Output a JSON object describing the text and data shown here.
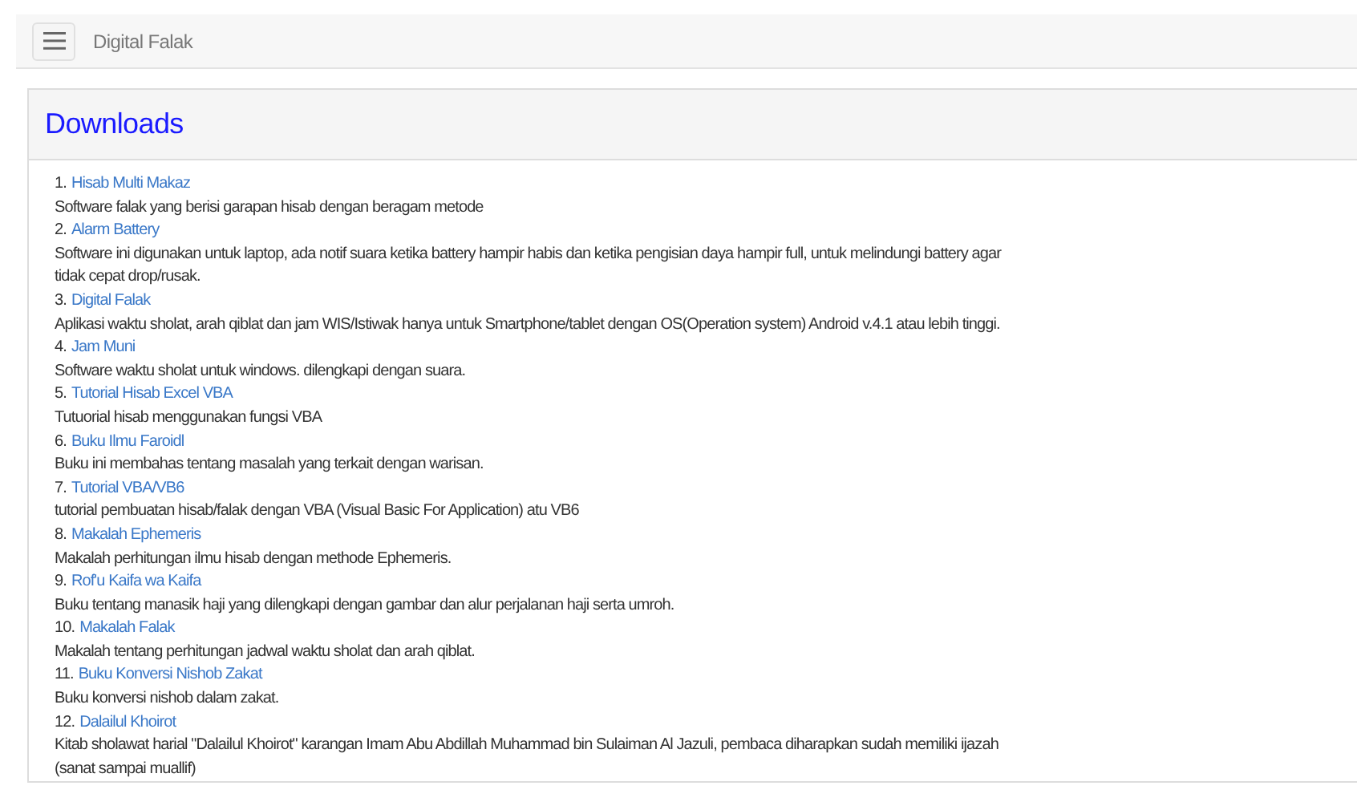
{
  "navbar": {
    "title": "Digital Falak"
  },
  "panel": {
    "title": "Downloads"
  },
  "items": [
    {
      "number": "1.",
      "link": "Hisab Multi Makaz",
      "description": "Software falak yang berisi garapan hisab dengan beragam metode"
    },
    {
      "number": "2.",
      "link": "Alarm Battery",
      "description": "Software ini digunakan untuk laptop, ada notif suara ketika battery hampir habis dan ketika pengisian daya hampir full, untuk melindungi battery agar tidak cepat drop/rusak."
    },
    {
      "number": "3.",
      "link": "Digital Falak",
      "description": "Aplikasi waktu sholat, arah qiblat dan jam WIS/Istiwak hanya untuk Smartphone/tablet dengan OS(Operation system) Android v.4.1 atau lebih tinggi."
    },
    {
      "number": "4.",
      "link": "Jam Muni",
      "description": "Software waktu sholat untuk windows. dilengkapi dengan suara."
    },
    {
      "number": "5.",
      "link": "Tutorial Hisab Excel VBA",
      "description": "Tutuorial hisab menggunakan fungsi VBA"
    },
    {
      "number": "6.",
      "link": "Buku Ilmu Faroidl",
      "description": "Buku ini membahas tentang masalah yang terkait dengan warisan."
    },
    {
      "number": "7.",
      "link": "Tutorial VBA/VB6",
      "description": "tutorial pembuatan hisab/falak dengan VBA (Visual Basic For Application) atu VB6"
    },
    {
      "number": "8.",
      "link": "Makalah Ephemeris",
      "description": "Makalah perhitungan ilmu hisab dengan methode Ephemeris."
    },
    {
      "number": "9.",
      "link": "Rof'u Kaifa wa Kaifa",
      "description": "Buku tentang manasik haji yang dilengkapi dengan gambar dan alur perjalanan haji serta umroh."
    },
    {
      "number": "10.",
      "link": "Makalah Falak",
      "description": "Makalah tentang perhitungan jadwal waktu sholat dan arah qiblat."
    },
    {
      "number": "11.",
      "link": "Buku Konversi Nishob Zakat",
      "description": "Buku konversi nishob dalam zakat."
    },
    {
      "number": "12.",
      "link": "Dalailul Khoirot",
      "description": "Kitab sholawat harial \"Dalailul Khoirot\" karangan Imam Abu Abdillah Muhammad bin Sulaiman Al Jazuli, pembaca diharapkan sudah memiliki ijazah (sanat sampai muallif)"
    }
  ]
}
